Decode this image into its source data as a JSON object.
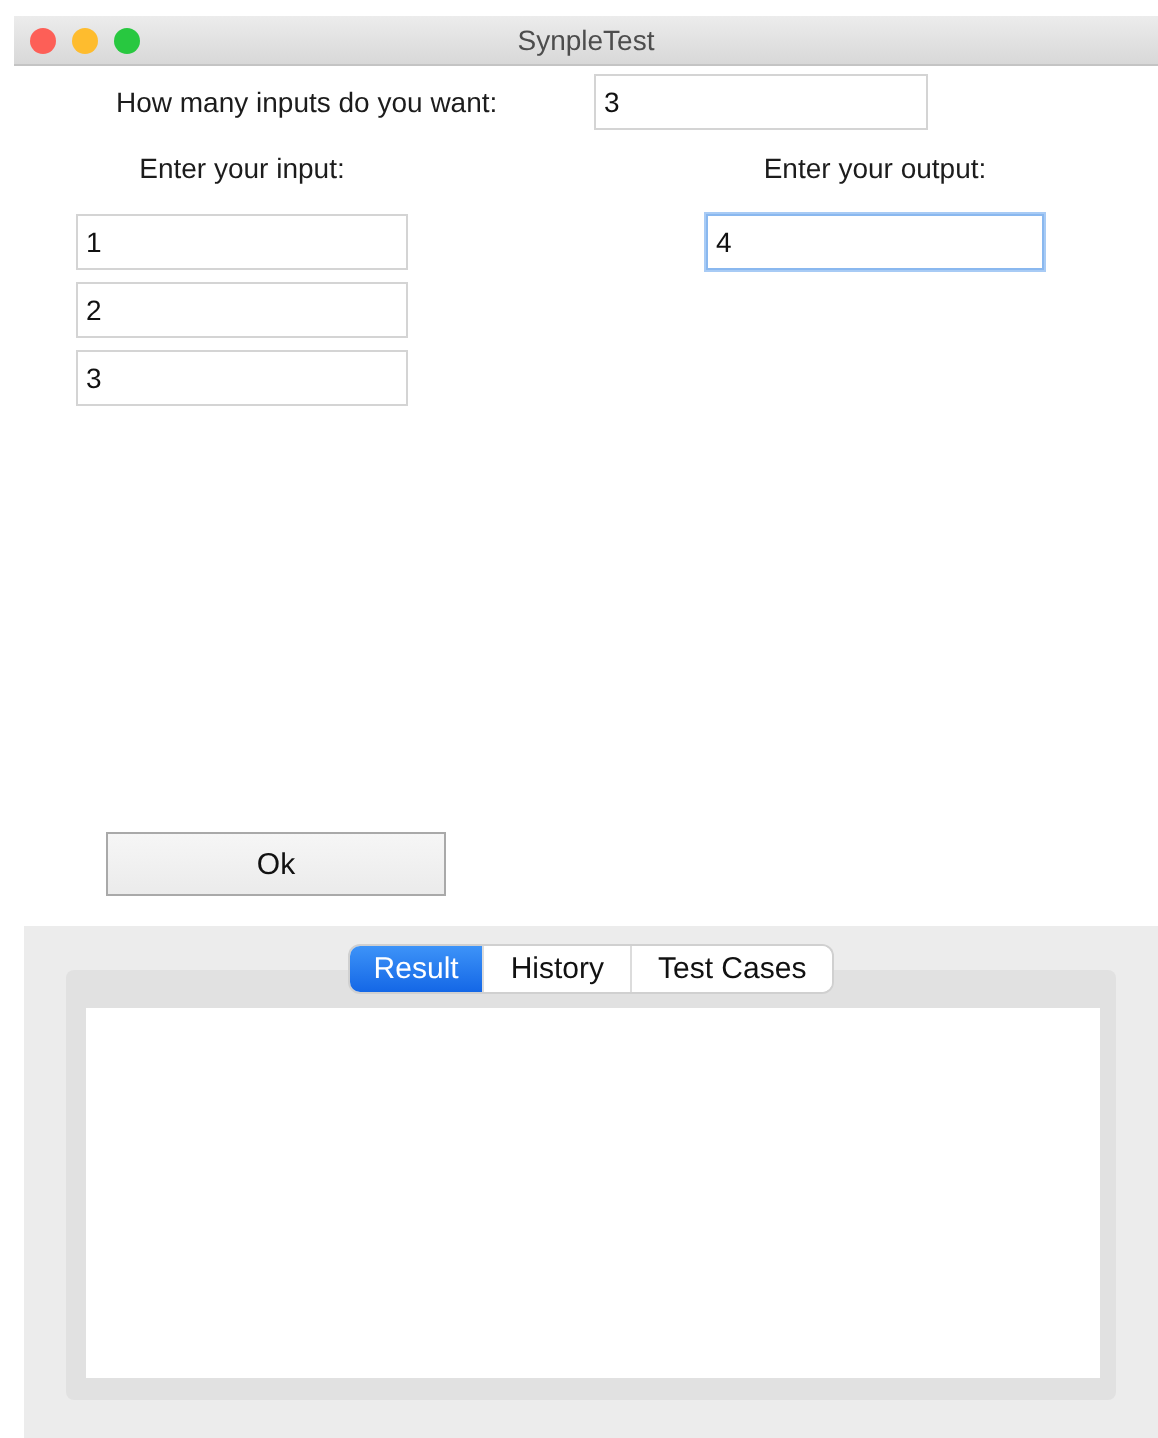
{
  "window": {
    "title": "SynpleTest"
  },
  "count": {
    "label": "How many inputs do you want:",
    "value": "3"
  },
  "inputs": {
    "label": "Enter your input:",
    "fields": [
      {
        "value": "1"
      },
      {
        "value": "2"
      },
      {
        "value": "3"
      }
    ]
  },
  "output": {
    "label": "Enter your output:",
    "value": "4",
    "focused": true
  },
  "ok_button": "Ok",
  "tabs": [
    {
      "label": "Result",
      "selected": true
    },
    {
      "label": "History",
      "selected": false
    },
    {
      "label": "Test Cases",
      "selected": false
    }
  ]
}
